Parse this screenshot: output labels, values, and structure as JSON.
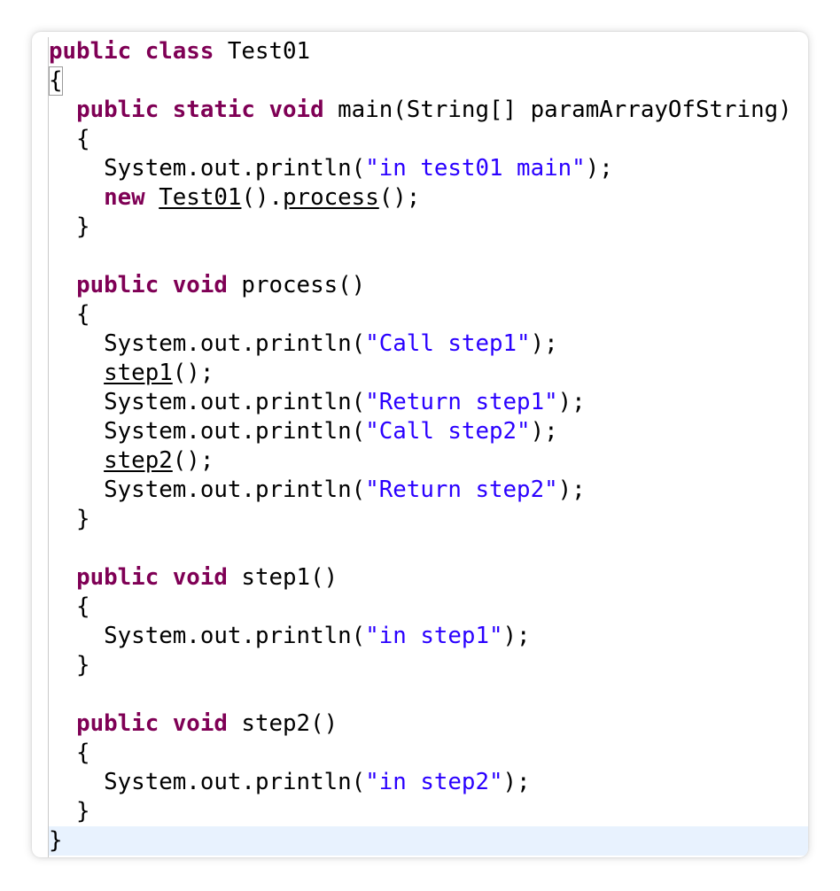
{
  "editor": {
    "language": "java",
    "lines": {
      "l1": {
        "kw": "public class",
        "text": " Test01"
      },
      "l2": {
        "text": "{"
      },
      "l3": {
        "indent": "  ",
        "kw": "public static void",
        "text": " main(String[] paramArrayOfString)"
      },
      "l4": {
        "text": "  {"
      },
      "l5": {
        "pre": "    System.out.println(",
        "str": "\"in test01 main\"",
        "post": ");"
      },
      "l6": {
        "indent": "    ",
        "kw": "new",
        "sp": " ",
        "cls": "Test01",
        "mid": "().",
        "call": "process",
        "post": "();"
      },
      "l7": {
        "text": "  }"
      },
      "l8": {
        "indent": "  ",
        "kw": "public void",
        "text": " process()"
      },
      "l9": {
        "text": "  {"
      },
      "l10": {
        "pre": "    System.out.println(",
        "str": "\"Call step1\"",
        "post": ");"
      },
      "l11": {
        "indent": "    ",
        "call": "step1",
        "post": "();"
      },
      "l12": {
        "pre": "    System.out.println(",
        "str": "\"Return step1\"",
        "post": ");"
      },
      "l13": {
        "pre": "    System.out.println(",
        "str": "\"Call step2\"",
        "post": ");"
      },
      "l14": {
        "indent": "    ",
        "call": "step2",
        "post": "();"
      },
      "l15": {
        "pre": "    System.out.println(",
        "str": "\"Return step2\"",
        "post": ");"
      },
      "l16": {
        "text": "  }"
      },
      "l17": {
        "indent": "  ",
        "kw": "public void",
        "text": " step1()"
      },
      "l18": {
        "text": "  {"
      },
      "l19": {
        "pre": "    System.out.println(",
        "str": "\"in step1\"",
        "post": ");"
      },
      "l20": {
        "text": "  }"
      },
      "l21": {
        "indent": "  ",
        "kw": "public void",
        "text": " step2()"
      },
      "l22": {
        "text": "  {"
      },
      "l23": {
        "pre": "    System.out.println(",
        "str": "\"in step2\"",
        "post": ");"
      },
      "l24": {
        "text": "  }"
      },
      "l25": {
        "text": "}"
      }
    }
  },
  "colors": {
    "keyword": "#7f0055",
    "string": "#2a00ff",
    "text": "#000000",
    "current_line": "#e8f2fe"
  }
}
